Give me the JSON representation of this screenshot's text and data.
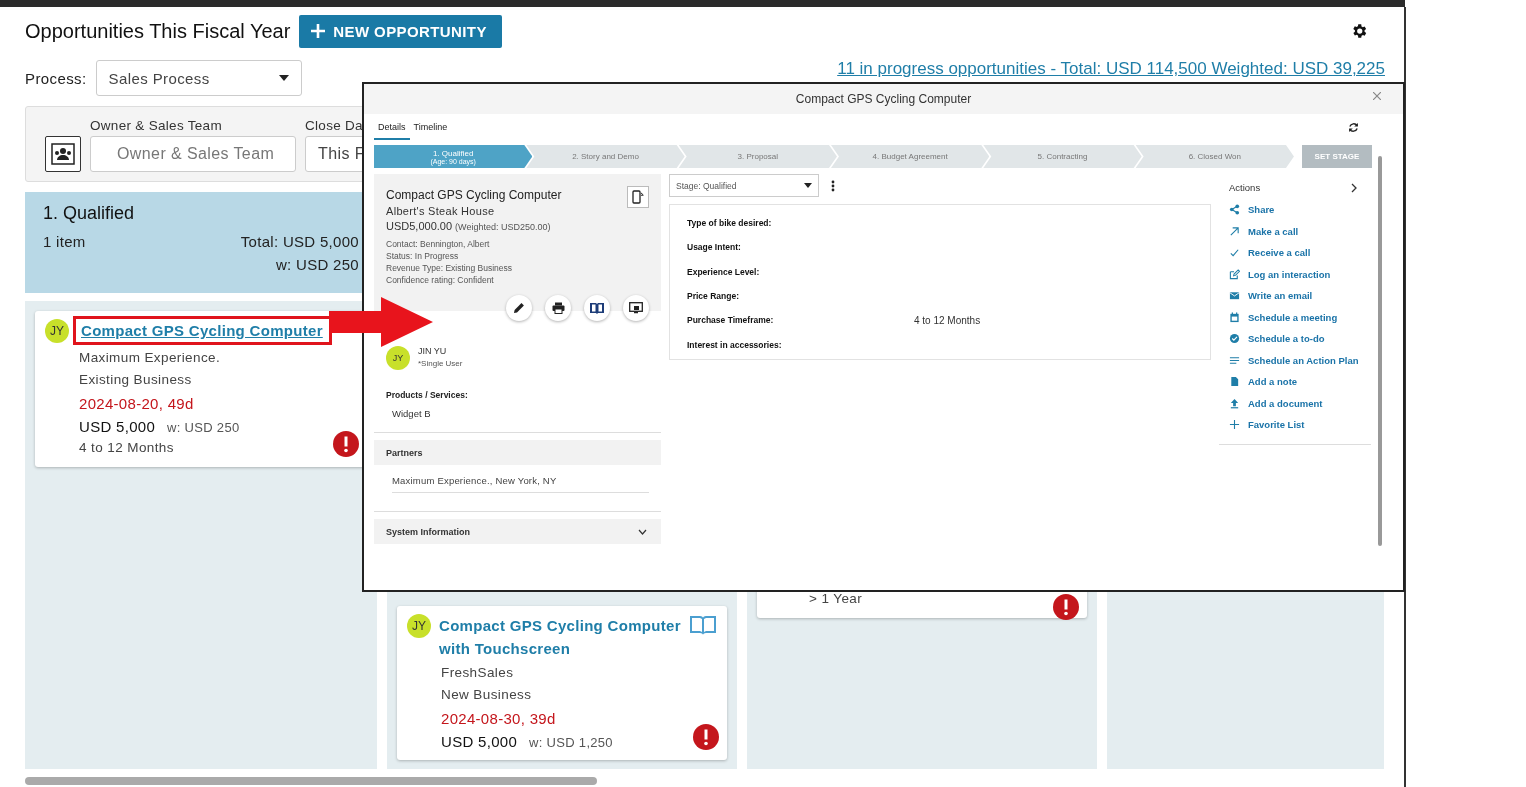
{
  "header": {
    "title": "Opportunities This Fiscal Year",
    "new_button": "NEW OPPORTUNITY",
    "process_label": "Process:",
    "process_value": "Sales Process",
    "summary": "11 in progress opportunities - Total: USD 114,500 Weighted: USD 39,225"
  },
  "filters": [
    {
      "label": "Owner & Sales Team",
      "placeholder": "Owner & Sales Team"
    },
    {
      "label": "Close Da",
      "value": "This F"
    }
  ],
  "lanes": [
    {
      "title": "1. Qualified",
      "count": "1 item",
      "total": "Total: USD 5,000",
      "weighted": "w: USD 250",
      "cards": [
        {
          "initials": "JY",
          "title": "Compact GPS Cycling Computer",
          "highlighted": true,
          "book": false,
          "company": "Maximum Experience.",
          "revenue_type": "Existing Business",
          "date": "2024-08-20, 49d",
          "amount": "USD 5,000",
          "weighted": "w: USD 250",
          "timeframe": "4 to 12 Months",
          "alert": true
        }
      ]
    },
    {
      "cards": [
        {
          "initials": "JY",
          "title": "Compact GPS Cycling Computer with Touchscreen",
          "highlighted": false,
          "book": true,
          "company": "FreshSales",
          "revenue_type": "New Business",
          "date": "2024-08-30, 39d",
          "amount": "USD 5,000",
          "weighted": "w: USD 1,250",
          "alert": true
        }
      ]
    },
    {
      "cards": [
        {
          "timeframe": "> 1 Year",
          "alert": true
        }
      ]
    }
  ],
  "modal": {
    "title": "Compact GPS Cycling Computer",
    "tabs": [
      {
        "label": "Details",
        "selected": true
      },
      {
        "label": "Timeline",
        "selected": false
      }
    ],
    "stages": [
      {
        "label": "1. Qualified",
        "sublabel": "(Age: 90 days)",
        "selected": true
      },
      {
        "label": "2. Story and Demo",
        "selected": false
      },
      {
        "label": "3. Proposal",
        "selected": false
      },
      {
        "label": "4. Budget Agreement",
        "selected": false
      },
      {
        "label": "5. Contracting",
        "selected": false
      },
      {
        "label": "6. Closed Won",
        "selected": false
      }
    ],
    "set_stage": {
      "label": "SET STAGE",
      "disabled": true
    },
    "summary": {
      "title": "Compact GPS Cycling Computer",
      "company": "Albert's Steak House",
      "amount": "USD5,000.00",
      "weighted": "(Weighted: USD250.00)",
      "details": [
        "Contact: Bennington, Albert",
        "Status: In Progress",
        "Revenue Type: Existing Business",
        "Confidence rating: Confident"
      ]
    },
    "owner": {
      "initials": "JY",
      "name": "JIN YU",
      "role": "*Single User"
    },
    "products": {
      "label": "Products / Services:",
      "items": [
        "Widget B"
      ]
    },
    "partners": {
      "title": "Partners",
      "items": [
        "Maximum Experience., New York, NY"
      ]
    },
    "system_info": {
      "title": "System Information",
      "expanded": false
    },
    "stage_select": "Stage: Qualified",
    "fields": [
      {
        "label": "Type of bike desired:"
      },
      {
        "label": "Usage Intent:"
      },
      {
        "label": "Experience Level:"
      },
      {
        "label": "Price Range:"
      },
      {
        "label": "Purchase Timeframe:",
        "value": "4 to 12 Months"
      },
      {
        "label": "Interest in accessories:"
      }
    ],
    "actions": {
      "title": "Actions",
      "items": [
        "Share",
        "Make a call",
        "Receive a call",
        "Log an interaction",
        "Write an email",
        "Schedule a meeting",
        "Schedule a to-do",
        "Schedule an Action Plan",
        "Add a note",
        "Add a document",
        "Favorite List"
      ]
    }
  }
}
